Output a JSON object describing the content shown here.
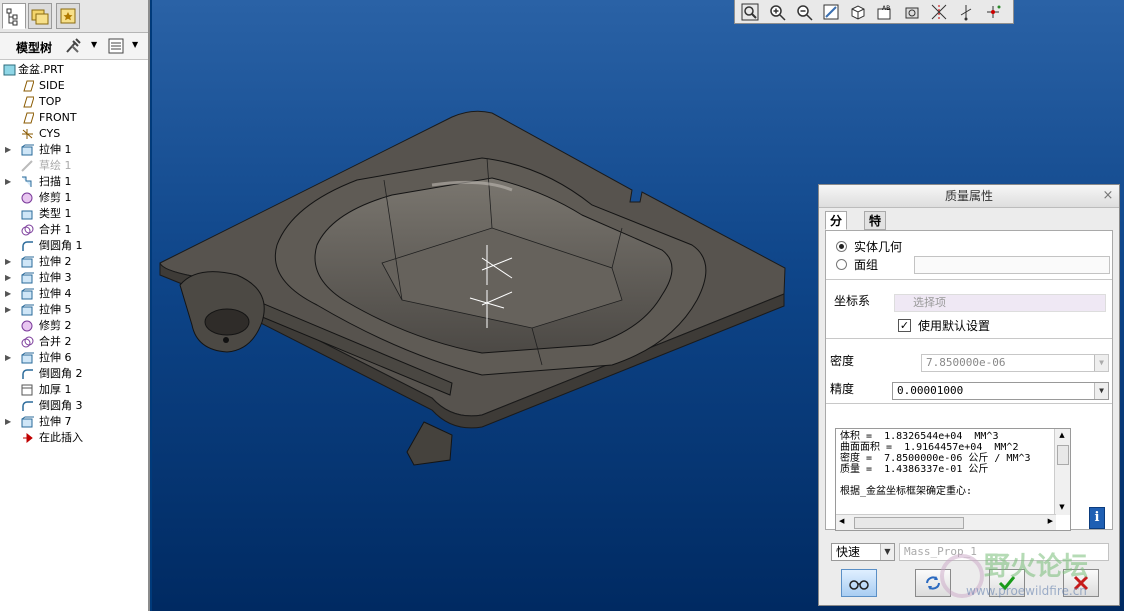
{
  "model_tree": {
    "title": "模型树",
    "items": [
      {
        "label": "金盆.PRT",
        "expand": false,
        "dim": false
      },
      {
        "label": "SIDE",
        "expand": false,
        "dim": false
      },
      {
        "label": "TOP",
        "expand": false,
        "dim": false
      },
      {
        "label": "FRONT",
        "expand": false,
        "dim": false
      },
      {
        "label": "CYS",
        "expand": false,
        "dim": false
      },
      {
        "label": "拉伸 1",
        "expand": true,
        "dim": false
      },
      {
        "label": "草绘 1",
        "expand": false,
        "dim": true
      },
      {
        "label": "扫描 1",
        "expand": true,
        "dim": false
      },
      {
        "label": "修剪 1",
        "expand": false,
        "dim": false
      },
      {
        "label": "类型 1",
        "expand": false,
        "dim": false
      },
      {
        "label": "合并 1",
        "expand": false,
        "dim": false
      },
      {
        "label": "倒圆角 1",
        "expand": false,
        "dim": false
      },
      {
        "label": "拉伸 2",
        "expand": true,
        "dim": false
      },
      {
        "label": "拉伸 3",
        "expand": true,
        "dim": false
      },
      {
        "label": "拉伸 4",
        "expand": true,
        "dim": false
      },
      {
        "label": "拉伸 5",
        "expand": true,
        "dim": false
      },
      {
        "label": "修剪 2",
        "expand": false,
        "dim": false
      },
      {
        "label": "合并 2",
        "expand": false,
        "dim": false
      },
      {
        "label": "拉伸 6",
        "expand": true,
        "dim": false
      },
      {
        "label": "倒圆角 2",
        "expand": false,
        "dim": false
      },
      {
        "label": "加厚 1",
        "expand": false,
        "dim": false
      },
      {
        "label": "倒圆角 3",
        "expand": false,
        "dim": false
      },
      {
        "label": "拉伸 7",
        "expand": true,
        "dim": false
      },
      {
        "label": "在此插入",
        "expand": false,
        "dim": false
      }
    ]
  },
  "toolbar_icons": [
    "zoom-fit-icon",
    "zoom-in-icon",
    "zoom-out-icon",
    "repaint-icon",
    "view-orient-icon",
    "saved-views-icon",
    "layers-icon",
    "datum-planes-icon",
    "datum-axes-icon",
    "datum-points-icon"
  ],
  "dialog": {
    "title": "质量属性",
    "close": "×",
    "tabs": [
      "分析",
      "特征"
    ],
    "solid_geometry": "实体几何",
    "quilt": "面组",
    "coord_sys_label": "坐标系",
    "select_placeholder": "选择项",
    "use_default": "使用默认设置",
    "density_label": "密度",
    "density_value": "7.850000e-06",
    "accuracy_label": "精度",
    "accuracy_value": "0.00001000",
    "results": "体积 =  1.8326544e+04  MM^3\n曲面面积 =  1.9164457e+04  MM^2\n密度 =  7.8500000e-06 公斤 / MM^3\n质量 =  1.4386337e-01 公斤\n\n根据_金盆坐标框架确定重心:",
    "mode": "快速",
    "name_value": "Mass_Prop_1"
  },
  "watermark": {
    "text": "野火论坛",
    "url": "www.proewildfire.cn"
  },
  "colors": {
    "viewport_top": "#2a62a6",
    "viewport_bottom": "#002a62",
    "part": "#5b5752",
    "ok": "#1a9b1a",
    "cancel": "#c61b1b"
  }
}
